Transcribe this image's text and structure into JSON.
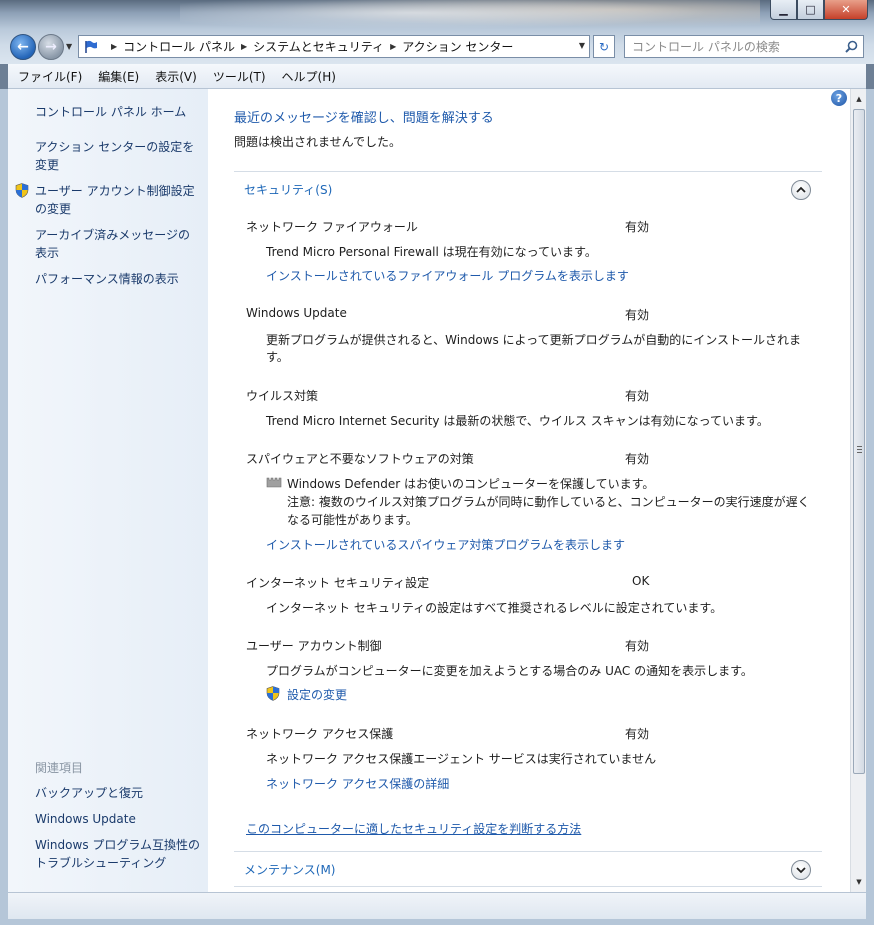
{
  "window": {
    "minimize_glyph": "▁",
    "maximize_glyph": "□",
    "close_glyph": "✕"
  },
  "nav": {
    "back_icon": "arrow-left-icon",
    "forward_icon": "arrow-right-icon",
    "breadcrumbs": [
      "コントロール パネル",
      "システムとセキュリティ",
      "アクション センター"
    ],
    "search_placeholder": "コントロール パネルの検索"
  },
  "menu": [
    "ファイル(F)",
    "編集(E)",
    "表示(V)",
    "ツール(T)",
    "ヘルプ(H)"
  ],
  "sidebar": {
    "home": "コントロール パネル ホーム",
    "settings": [
      "アクション センターの設定を",
      "変更"
    ],
    "uac": [
      "ユーザー アカウント制御設定",
      "の変更"
    ],
    "archived": [
      "アーカイブ済みメッセージの",
      "表示"
    ],
    "performance": "パフォーマンス情報の表示",
    "related_heading": "関連項目",
    "related": [
      "バックアップと復元",
      "Windows Update",
      "Windows プログラム互換性の",
      "トラブルシューティング"
    ]
  },
  "main": {
    "headline": "最近のメッセージを確認し、問題を解決する",
    "no_problems": "問題は検出されませんでした。",
    "security_section": "セキュリティ(S)",
    "items": {
      "firewall": {
        "title": "ネットワーク ファイアウォール",
        "status": "有効",
        "desc": "Trend Micro Personal Firewall は現在有効になっています。",
        "link": "インストールされているファイアウォール プログラムを表示します"
      },
      "update": {
        "title": "Windows Update",
        "status": "有効",
        "desc_line1": "更新プログラムが提供されると、Windows によって更新プログラムが自動的にインストールされま",
        "desc_line2": "す。"
      },
      "virus": {
        "title": "ウイルス対策",
        "status": "有効",
        "desc": "Trend Micro Internet Security は最新の状態で、ウイルス スキャンは有効になっています。"
      },
      "spyware": {
        "title": "スパイウェアと不要なソフトウェアの対策",
        "status": "有効",
        "desc_line1": "Windows Defender はお使いのコンピューターを保護しています。",
        "desc_line2": "注意: 複数のウイルス対策プログラムが同時に動作していると、コンピューターの実行速度が遅く",
        "desc_line3": "なる可能性があります。",
        "link": "インストールされているスパイウェア対策プログラムを表示します"
      },
      "internet": {
        "title": "インターネット セキュリティ設定",
        "status": "OK",
        "desc": "インターネット セキュリティの設定はすべて推奨されるレベルに設定されています。"
      },
      "uac": {
        "title": "ユーザー アカウント制御",
        "status": "有効",
        "desc": "プログラムがコンピューターに変更を加えようとする場合のみ UAC の通知を表示します。",
        "link": "設定の変更"
      },
      "nap": {
        "title": "ネットワーク アクセス保護",
        "status": "有効",
        "desc": "ネットワーク アクセス保護エージェント サービスは実行されていません",
        "link": "ネットワーク アクセス保護の詳細"
      }
    },
    "security_help_link": "このコンピューターに適したセキュリティ設定を判断する方法",
    "maintenance_section": "メンテナンス(M)"
  }
}
